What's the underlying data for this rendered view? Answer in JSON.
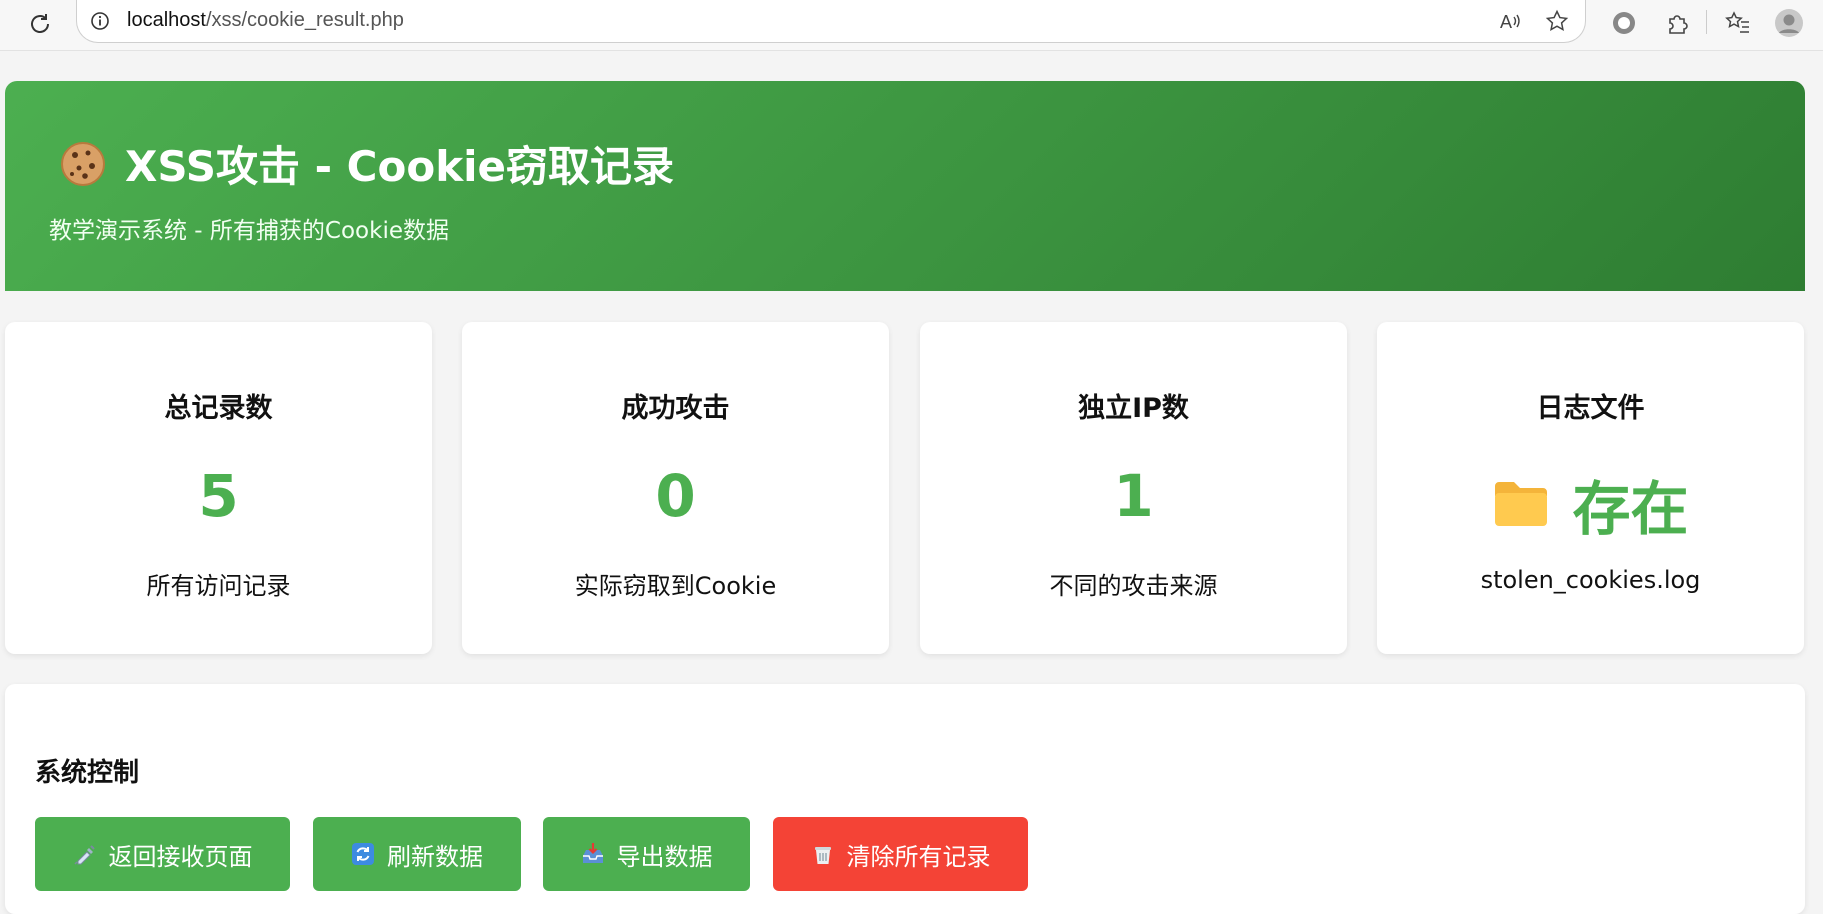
{
  "browser": {
    "url_host": "localhost",
    "url_path": "/xss/cookie_result.php"
  },
  "header": {
    "title": "XSS攻击 - Cookie窃取记录",
    "subtitle": "教学演示系统 - 所有捕获的Cookie数据"
  },
  "stats": [
    {
      "label": "总记录数",
      "value": "5",
      "desc": "所有访问记录"
    },
    {
      "label": "成功攻击",
      "value": "0",
      "desc": "实际窃取到Cookie"
    },
    {
      "label": "独立IP数",
      "value": "1",
      "desc": "不同的攻击来源"
    },
    {
      "label": "日志文件",
      "value": "存在",
      "desc": "stolen_cookies.log",
      "icon": "folder-icon"
    }
  ],
  "controls": {
    "title": "系统控制",
    "buttons": [
      {
        "label": "返回接收页面",
        "icon": "syringe-icon",
        "color": "#4caf50"
      },
      {
        "label": "刷新数据",
        "icon": "refresh-icon",
        "color": "#4caf50"
      },
      {
        "label": "导出数据",
        "icon": "inbox-icon",
        "color": "#4caf50"
      },
      {
        "label": "清除所有记录",
        "icon": "trash-icon",
        "color": "#f44336"
      }
    ]
  },
  "colors": {
    "accent": "#4caf50",
    "accent_dark": "#2e7d32",
    "danger": "#f44336"
  }
}
